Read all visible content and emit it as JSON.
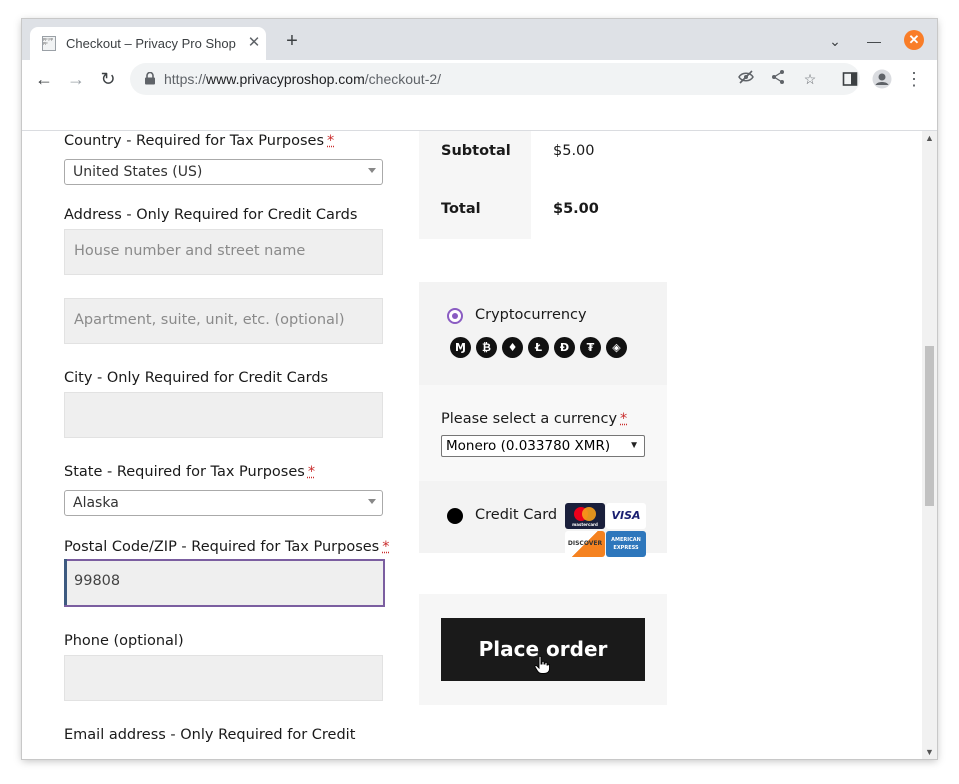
{
  "browser": {
    "tab_title": "Checkout – Privacy Pro Shop",
    "new_tab_glyph": "+",
    "url_scheme": "https://",
    "url_host": "www.privacyproshop.com",
    "url_path": "/checkout-2/",
    "icons": [
      "back-icon",
      "forward-icon",
      "reload-icon",
      "lock-icon",
      "eye-off-icon",
      "share-icon",
      "star-icon",
      "side-panel-icon",
      "profile-icon",
      "menu-icon"
    ]
  },
  "form": {
    "country_label": "Country - Required for Tax Purposes",
    "country_value": "United States (US)",
    "address_label": "Address - Only Required for Credit Cards",
    "address1_placeholder": "House number and street name",
    "address2_placeholder": "Apartment, suite, unit, etc. (optional)",
    "city_label": "City - Only Required for Credit Cards",
    "state_label": "State - Required for Tax Purposes",
    "state_value": "Alaska",
    "postal_label": "Postal Code/ZIP - Required for Tax Purposes",
    "postal_value": "99808",
    "phone_label": "Phone (optional)",
    "email_label": "Email address - Only Required for Credit",
    "required_mark": "*"
  },
  "summary": {
    "subtotal_label": "Subtotal",
    "subtotal_value": "$5.00",
    "total_label": "Total",
    "total_value": "$5.00"
  },
  "payment": {
    "crypto_label": "Cryptocurrency",
    "coins": [
      "Ɱ",
      "₿",
      "♦",
      "Ł",
      "Đ",
      "₮",
      "◈"
    ],
    "currency_label": "Please select a currency",
    "currency_value": "Monero (0.033780 XMR)",
    "credit_label": "Credit Card",
    "cards": [
      "mastercard",
      "VISA",
      "DISCOVER",
      "AMERICAN EXPRESS"
    ],
    "colors": {
      "accent": "#8a5cc2",
      "focus_border": "#7b5ea0",
      "required": "#c92c2c"
    }
  },
  "order": {
    "place_order_label": "Place order"
  }
}
